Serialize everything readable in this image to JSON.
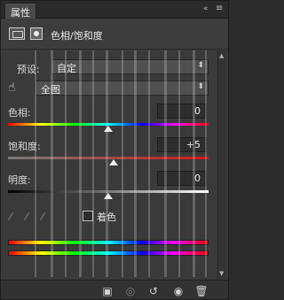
{
  "panel": {
    "tab_label": "属性",
    "collapse_glyph": "«",
    "menu_glyph": "≡"
  },
  "title": {
    "label": "色相/饱和度"
  },
  "preset": {
    "label": "预设:",
    "value": "自定"
  },
  "channel": {
    "value": "全图"
  },
  "hue": {
    "label": "色相:",
    "value": "0",
    "level": 0
  },
  "saturation": {
    "label": "饱和度:",
    "value": "+5",
    "level": 5
  },
  "lightness": {
    "label": "明度:",
    "value": "0",
    "level": 0
  },
  "colorize": {
    "label": "着色",
    "checked": false
  },
  "icons": {
    "hand": "hand-icon",
    "eyedropper": "eyedropper-icon",
    "eyedropper_plus": "eyedropper-plus-icon",
    "eyedropper_minus": "eyedropper-minus-icon",
    "clip_to_layer": "clip-to-layer-icon",
    "view_previous": "view-previous-icon",
    "reset": "reset-icon",
    "visibility": "eye-icon",
    "delete": "trash-icon"
  }
}
